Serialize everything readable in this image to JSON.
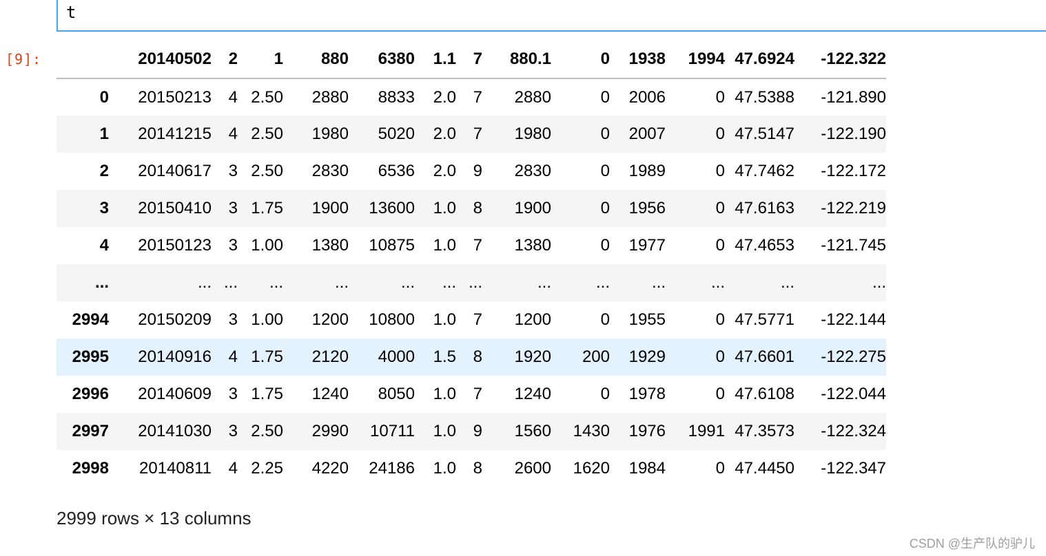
{
  "cell": {
    "code": "t",
    "prompt": "[9]:"
  },
  "table": {
    "columns": [
      "20140502",
      "2",
      "1",
      "880",
      "6380",
      "1.1",
      "7",
      "880.1",
      "0",
      "1938",
      "1994",
      "47.6924",
      "-122.322"
    ],
    "rows": [
      {
        "index": "0",
        "cells": [
          "20150213",
          "4",
          "2.50",
          "2880",
          "8833",
          "2.0",
          "7",
          "2880",
          "0",
          "2006",
          "0",
          "47.5388",
          "-121.890"
        ]
      },
      {
        "index": "1",
        "cells": [
          "20141215",
          "4",
          "2.50",
          "1980",
          "5020",
          "2.0",
          "7",
          "1980",
          "0",
          "2007",
          "0",
          "47.5147",
          "-122.190"
        ]
      },
      {
        "index": "2",
        "cells": [
          "20140617",
          "3",
          "2.50",
          "2830",
          "6536",
          "2.0",
          "9",
          "2830",
          "0",
          "1989",
          "0",
          "47.7462",
          "-122.172"
        ]
      },
      {
        "index": "3",
        "cells": [
          "20150410",
          "3",
          "1.75",
          "1900",
          "13600",
          "1.0",
          "8",
          "1900",
          "0",
          "1956",
          "0",
          "47.6163",
          "-122.219"
        ]
      },
      {
        "index": "4",
        "cells": [
          "20150123",
          "3",
          "1.00",
          "1380",
          "10875",
          "1.0",
          "7",
          "1380",
          "0",
          "1977",
          "0",
          "47.4653",
          "-121.745"
        ]
      },
      {
        "index": "...",
        "cells": [
          "...",
          "...",
          "...",
          "...",
          "...",
          "...",
          "...",
          "...",
          "...",
          "...",
          "...",
          "...",
          "..."
        ]
      },
      {
        "index": "2994",
        "cells": [
          "20150209",
          "3",
          "1.00",
          "1200",
          "10800",
          "1.0",
          "7",
          "1200",
          "0",
          "1955",
          "0",
          "47.5771",
          "-122.144"
        ]
      },
      {
        "index": "2995",
        "cells": [
          "20140916",
          "4",
          "1.75",
          "2120",
          "4000",
          "1.5",
          "8",
          "1920",
          "200",
          "1929",
          "0",
          "47.6601",
          "-122.275"
        ]
      },
      {
        "index": "2996",
        "cells": [
          "20140609",
          "3",
          "1.75",
          "1240",
          "8050",
          "1.0",
          "7",
          "1240",
          "0",
          "1978",
          "0",
          "47.6108",
          "-122.044"
        ]
      },
      {
        "index": "2997",
        "cells": [
          "20141030",
          "3",
          "2.50",
          "2990",
          "10711",
          "1.0",
          "9",
          "1560",
          "1430",
          "1976",
          "1991",
          "47.3573",
          "-122.324"
        ]
      },
      {
        "index": "2998",
        "cells": [
          "20140811",
          "4",
          "2.25",
          "4220",
          "24186",
          "1.0",
          "8",
          "2600",
          "1620",
          "1984",
          "0",
          "47.4450",
          "-122.347"
        ]
      }
    ],
    "summary": "2999 rows × 13 columns"
  },
  "watermark": "CSDN @生产队的驴儿"
}
